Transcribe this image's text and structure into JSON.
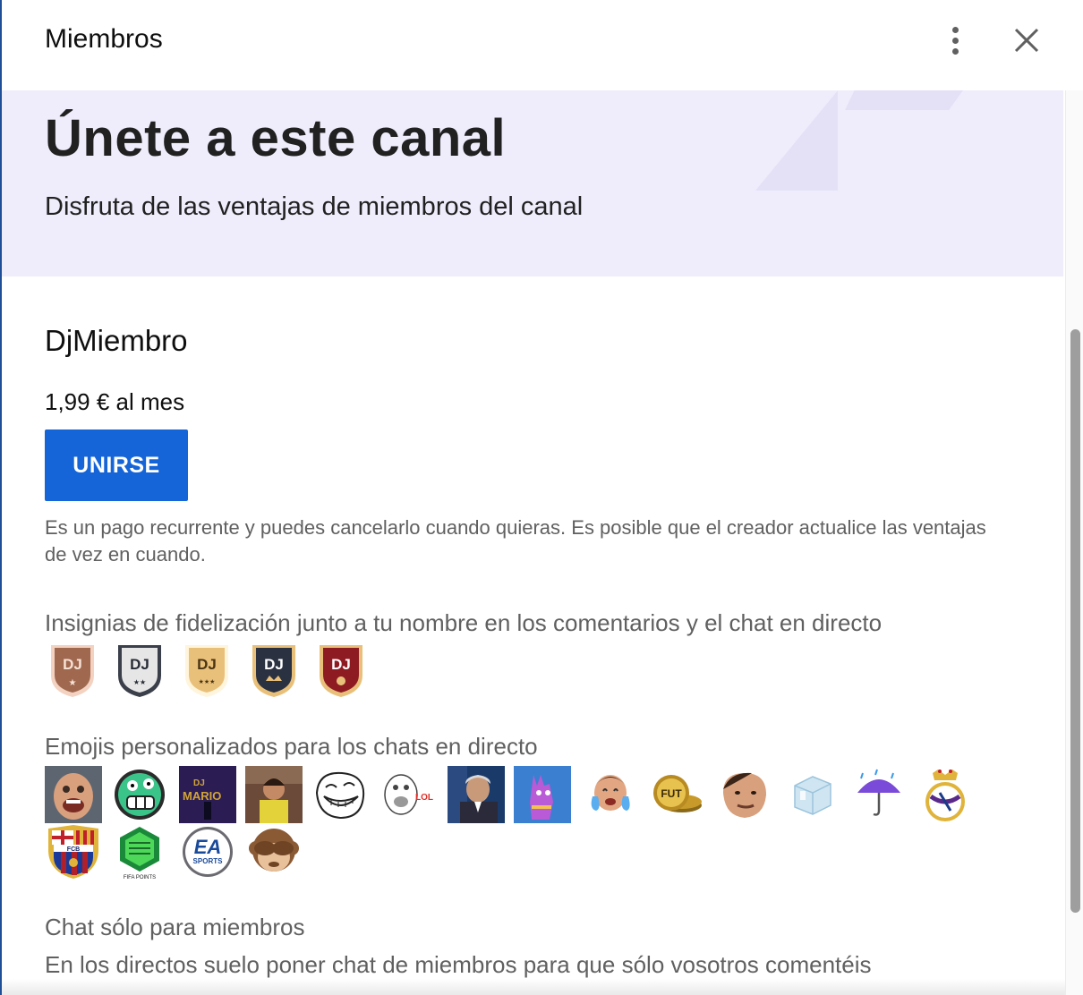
{
  "header": {
    "title": "Miembros"
  },
  "banner": {
    "title": "Únete a este canal",
    "subtitle": "Disfruta de las ventajas de miembros del canal"
  },
  "tier": {
    "name": "DjMiembro",
    "price": "1,99 € al mes",
    "join_label": "UNIRSE",
    "disclaimer": "Es un pago recurrente y puedes cancelarlo cuando quieras. Es posible que el creador actualice las ventajas de vez en cuando."
  },
  "perks": {
    "badges_label": "Insignias de fidelización junto a tu nombre en los comentarios y el chat en directo",
    "badge_text": "DJ",
    "emojis_label": "Emojis personalizados para los chats en directo",
    "emoji_texts": {
      "dj_mario_line1": "DJ",
      "dj_mario_line2": "MARIO",
      "lol": "LOL",
      "fut": "FUT",
      "ea": "EA",
      "sports": "SPORTS",
      "fifa_points": "FIFA POINTS",
      "fcb": "FCB"
    },
    "chat_label": "Chat sólo para miembros",
    "chat_desc": "En los directos suelo poner chat de miembros para que sólo vosotros comentéis"
  },
  "colors": {
    "banner_bg": "#efedfb",
    "join_button": "#1565d8",
    "badge_bronze": "#a0684f",
    "badge_silver": "#e6e6e6",
    "badge_gold": "#e9c07a",
    "badge_dark": "#2a3140",
    "badge_red": "#8e1a22"
  },
  "icons": {
    "more": "more-vert-icon",
    "close": "close-icon"
  }
}
